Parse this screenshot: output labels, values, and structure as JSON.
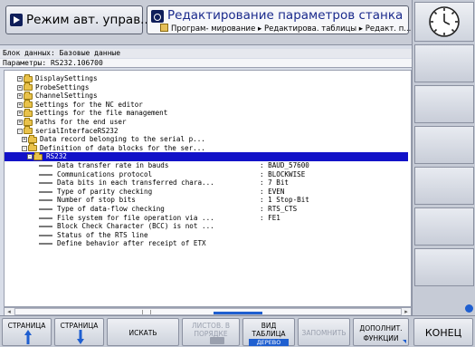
{
  "header": {
    "mode_label": "Режим авт. управ...",
    "program_title": "Редактирование параметров станка",
    "breadcrumb": "Програм- мирование ▸ Редактирова. таблицы ▸ Редакт. п..."
  },
  "info": {
    "data_block": "Блок данных: Базовые данные",
    "parameters": "Параметры: RS232.106700"
  },
  "tree": {
    "folders": [
      {
        "label": "DisplaySettings",
        "expander": "+"
      },
      {
        "label": "ProbeSettings",
        "expander": "+"
      },
      {
        "label": "ChannelSettings",
        "expander": "+"
      },
      {
        "label": "Settings for the NC editor",
        "expander": "+"
      },
      {
        "label": "Settings for the file management",
        "expander": "+"
      },
      {
        "label": "Paths for the end user",
        "expander": "+"
      },
      {
        "label": "serialInterfaceRS232",
        "expander": "-"
      },
      {
        "label": "Data record belonging to the serial p...",
        "expander": "+"
      },
      {
        "label": "Definition of data blocks for the ser...",
        "expander": "-"
      }
    ],
    "selected": {
      "label": "RS232",
      "expander": "-"
    },
    "params": [
      {
        "label": "Data transfer rate in bauds",
        "value": ": BAUD_57600"
      },
      {
        "label": "Communications protocol",
        "value": ": BLOCKWISE"
      },
      {
        "label": "Data bits in each transferred chara...",
        "value": ": 7 Bit"
      },
      {
        "label": "Type of parity checking",
        "value": ": EVEN"
      },
      {
        "label": "Number of stop bits",
        "value": ": 1 Stop-Bit"
      },
      {
        "label": "Type of data-flow checking",
        "value": ": RTS_CTS"
      },
      {
        "label": "File system for file operation via ...",
        "value": ": FE1"
      },
      {
        "label": "Block Check Character (BCC) is not ...",
        "value": ""
      },
      {
        "label": "Status of the RTS line",
        "value": ""
      },
      {
        "label": "Define behavior after receipt of ETX",
        "value": ""
      }
    ]
  },
  "softkeys": {
    "page_up": "СТРАНИЦА",
    "page_down": "СТРАНИЦА",
    "search": "ИСКАТЬ",
    "sheets_line1": "ЛИСТОВ. В",
    "sheets_line2": "ПОРЯДКЕ",
    "view_line1": "ВИД",
    "view_line2": "ТАБЛИЦА",
    "view_badge": "ДЕРЕВО",
    "save": "ЗАПОМНИТЬ",
    "more_line1": "ДОПОЛНИТ.",
    "more_line2": "ФУНКЦИИ",
    "end": "КОНЕЦ"
  },
  "colors": {
    "selection": "#1212c8",
    "accent_blue": "#1f5fd0",
    "title_blue": "#1a2a8c",
    "folder_yellow": "#e9c24a"
  }
}
